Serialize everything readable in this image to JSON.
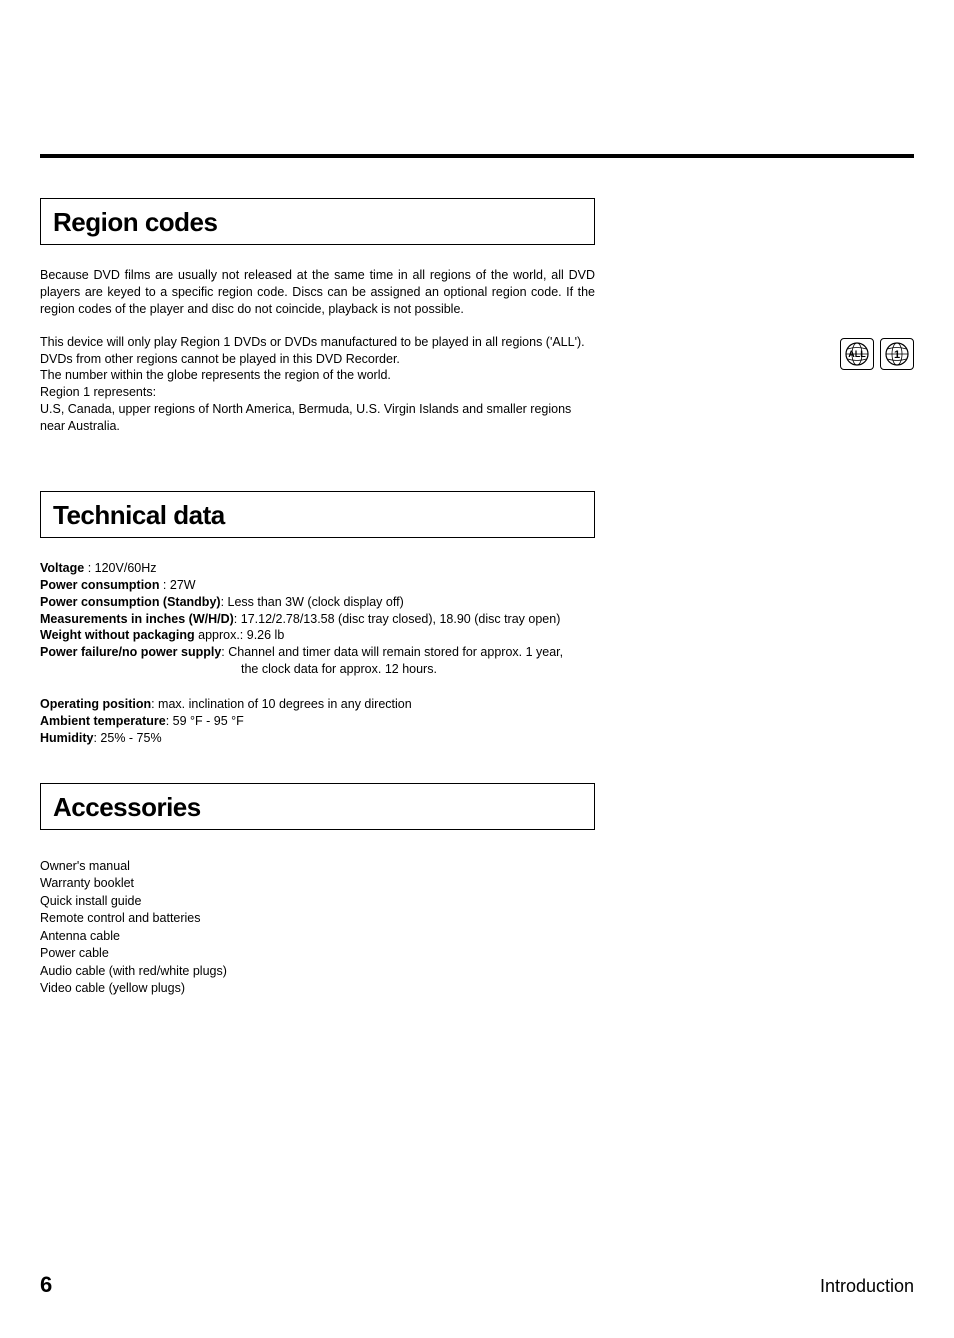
{
  "sections": {
    "region": {
      "title": "Region codes",
      "para1": "Because DVD films are usually not released at the same time in all regions of the world, all DVD players are keyed to a specific region code. Discs can be assigned an optional region code. If the region codes of the player and disc do not coincide, playback is not possible.",
      "para2_l1": "This device will only play Region 1 DVDs or DVDs manufactured to be played in all regions ('ALL').",
      "para2_l2": "DVDs from other regions cannot be played in this DVD Recorder.",
      "para2_l3": "The number within the globe represents the region of the world.",
      "para2_l4": "Region 1 represents:",
      "para2_l5": "U.S, Canada, upper regions of North America, Bermuda, U.S. Virgin Islands and smaller regions near Australia.",
      "icon1": "ALL",
      "icon2": "1"
    },
    "technical": {
      "title": "Technical data",
      "rows": {
        "voltage_label": "Voltage",
        "voltage_value": " : 120V/60Hz",
        "power_label": "Power consumption",
        "power_value": " : 27W",
        "power_standby_label": "Power consumption (Standby)",
        "power_standby_value": ": Less than 3W (clock display off)",
        "measurements_label": "Measurements in inches (W/H/D)",
        "measurements_value": ": 17.12/2.78/13.58 (disc tray closed), 18.90 (disc tray open)",
        "weight_label": "Weight without packaging",
        "weight_value": " approx.: 9.26 lb",
        "power_failure_label": "Power failure/no power supply",
        "power_failure_value": ":  Channel and timer data will remain stored for approx. 1 year,",
        "power_failure_value2": "the clock data for approx. 12 hours.",
        "operating_label": "Operating position",
        "operating_value": ": max. inclination of 10 degrees in any direction",
        "ambient_label": "Ambient temperature",
        "ambient_value": ": 59 °F - 95 °F",
        "humidity_label": "Humidity",
        "humidity_value": ": 25% - 75%"
      }
    },
    "accessories": {
      "title": "Accessories",
      "items": [
        "Owner's manual",
        "Warranty booklet",
        "Quick install guide",
        "Remote control and batteries",
        "Antenna cable",
        "Power cable",
        "Audio cable (with red/white plugs)",
        "Video cable (yellow plugs)"
      ]
    }
  },
  "footer": {
    "page": "6",
    "label": "Introduction"
  }
}
